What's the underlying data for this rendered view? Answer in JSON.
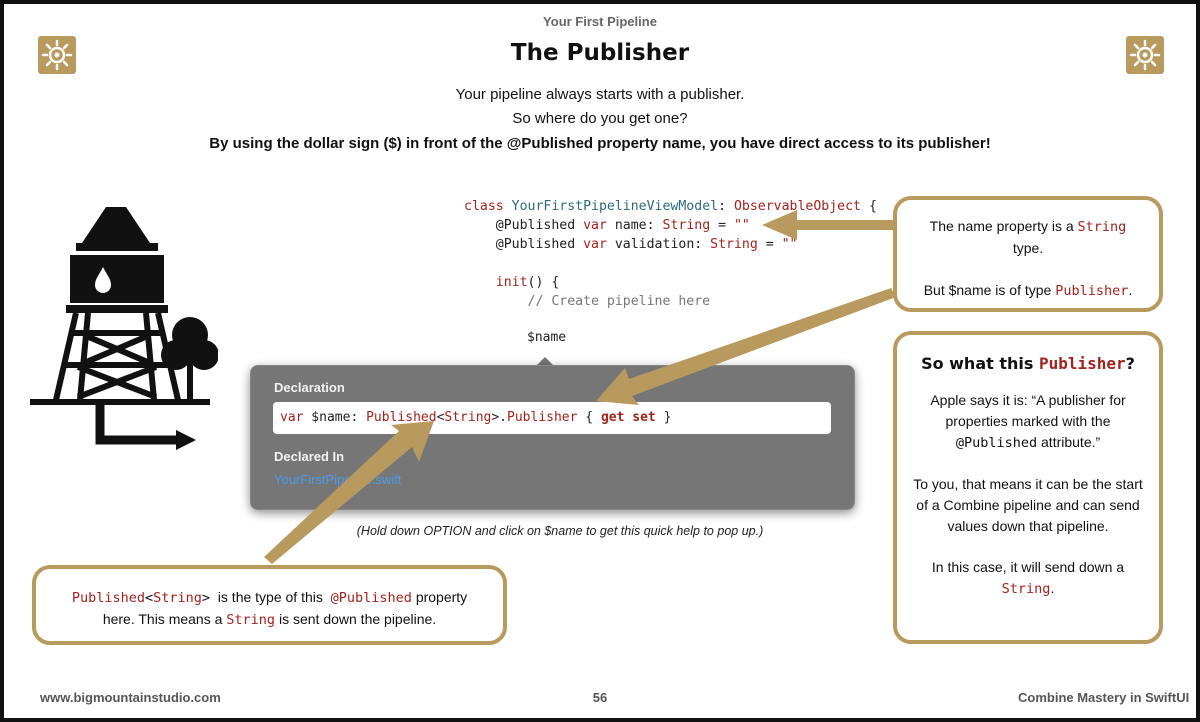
{
  "header": {
    "chapter": "Your First Pipeline",
    "title": "The Publisher"
  },
  "intro": {
    "line1": "Your pipeline always starts with a publisher.",
    "line2": "So where do you get one?",
    "line3": "By using the dollar sign ($) in front of the @Published property name, you have direct access to its publisher!"
  },
  "code": {
    "l1_kw": "class ",
    "l1_name": "YourFirstPipelineViewModel",
    "l1_colon": ": ",
    "l1_type": "ObservableObject",
    "l1_end": " {",
    "l2_a": "    @Published ",
    "l2_kw": "var",
    "l2_b": " name: ",
    "l2_type": "String",
    "l2_c": " = ",
    "l2_str": "\"\"",
    "l3_a": "    @Published ",
    "l3_kw": "var",
    "l3_b": " validation: ",
    "l3_type": "String",
    "l3_c": " = ",
    "l3_str": "\"\"",
    "l5_kw": "    init",
    "l5_b": "() {",
    "l6_comment": "        // Create pipeline here",
    "tag": "$name"
  },
  "quickhelp": {
    "declaration_label": "Declaration",
    "decl_kw": "var",
    "decl_a": " $name: ",
    "decl_type1": "Published",
    "decl_b": "<",
    "decl_type2": "String",
    "decl_c": ">.",
    "decl_type3": "Publisher",
    "decl_d": " { ",
    "decl_get": "get",
    "decl_e": " ",
    "decl_set": "set",
    "decl_f": " }",
    "declared_in_label": "Declared In",
    "file": "YourFirstPipeline.swift"
  },
  "caption": "(Hold down OPTION and click on $name to get this quick help to pop up.)",
  "callout_type": {
    "a": "The name property is a ",
    "string": "String",
    "b": "type.",
    "c": "But $name is of type ",
    "publisher": "Publisher",
    "d": "."
  },
  "callout_what": {
    "heading_a": "So what this ",
    "heading_pub": "Publisher",
    "heading_b": "?",
    "p1_a": "Apple says it is: “A publisher for properties marked with the ",
    "p1_mono": "@Published",
    "p1_b": " attribute.”",
    "p2": "To you, that means it can be the start of a Combine pipeline and can send values down that pipeline.",
    "p3_a": "In this case, it will send down a ",
    "p3_str": "String",
    "p3_b": "."
  },
  "callout_published": {
    "pub": "Published",
    "lt": "<",
    "string": "String",
    "gt": ">",
    "a": "  is the type of this  ",
    "atpub": "@Published",
    "b": " property",
    "c": "here. This means a ",
    "string2": "String",
    "d": " is sent down the pipeline."
  },
  "footer": {
    "website": "www.bigmountainstudio.com",
    "page": "56",
    "book": "Combine Mastery in SwiftUI"
  },
  "colors": {
    "accent": "#b89a5e",
    "keyword": "#a3231c",
    "type": "#2f6b78",
    "link": "#4c9be8"
  }
}
